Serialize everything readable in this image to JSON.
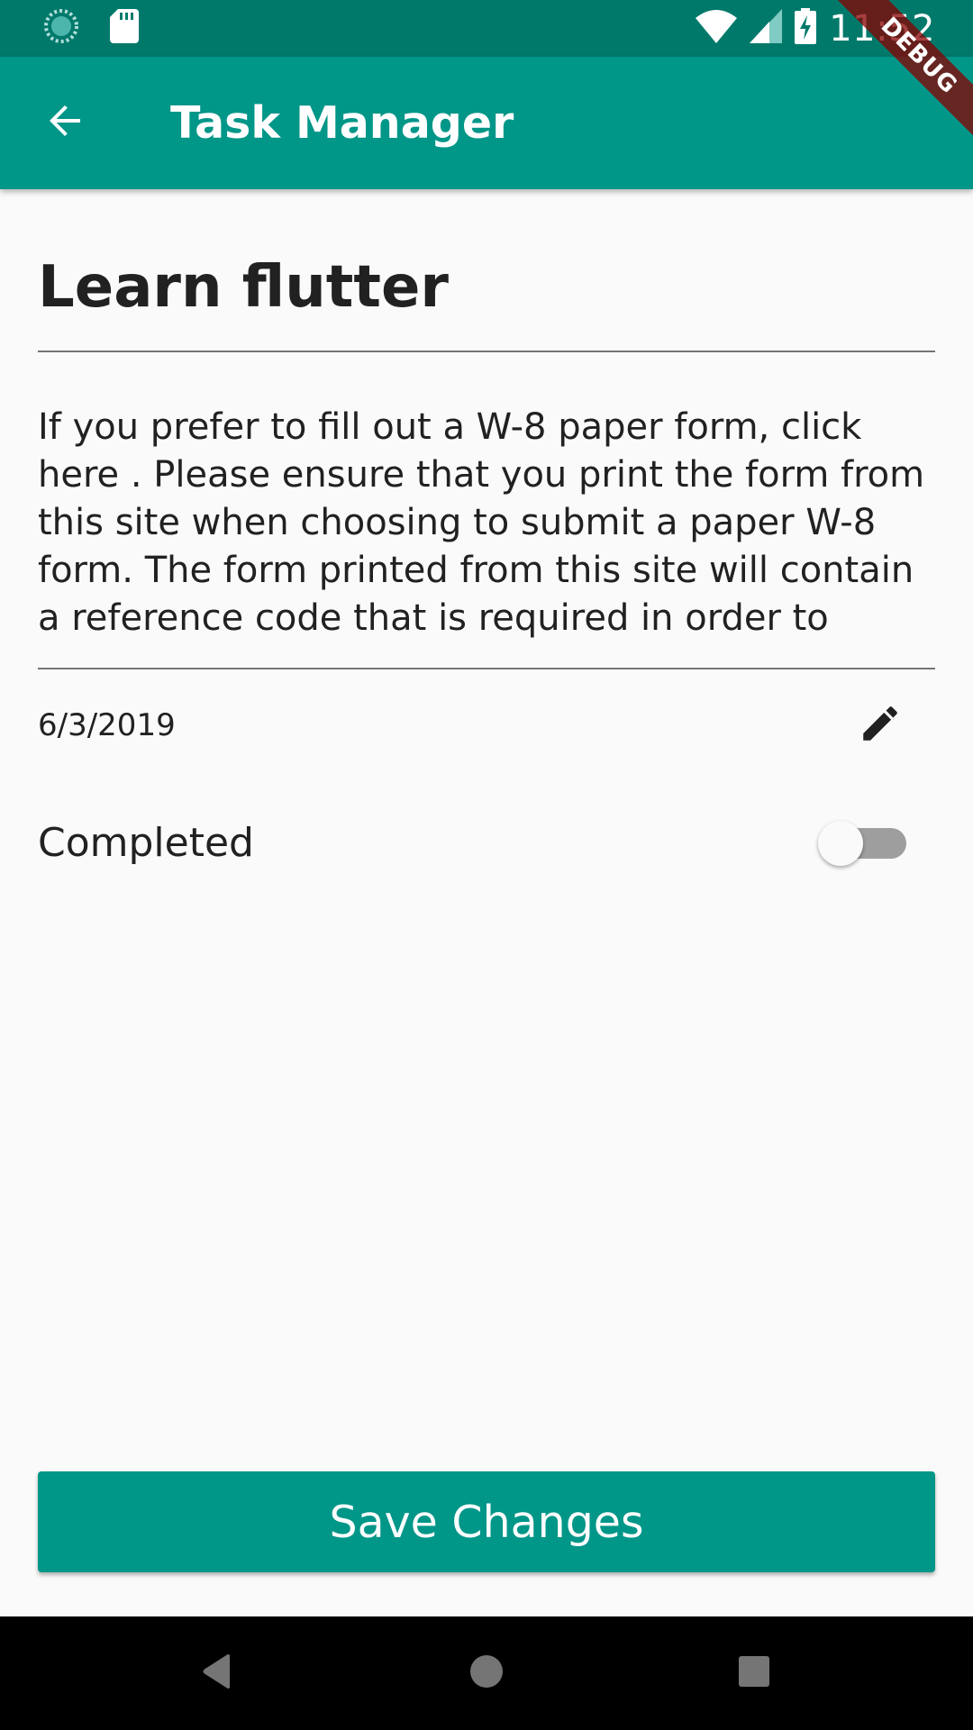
{
  "status_bar": {
    "time": "11:52",
    "icons": [
      "sync-icon",
      "sd-card-icon",
      "wifi-icon",
      "signal-icon",
      "battery-charging-icon"
    ]
  },
  "app_bar": {
    "title": "Task Manager",
    "back_icon": "arrow-back-icon"
  },
  "debug_banner": "DEBUG",
  "task": {
    "title": "Learn flutter",
    "description": "If you prefer to fill out a W-8 paper form, click here . Please ensure that you print the form from this site when choosing to submit a paper W-8 form. The form printed from this site will contain a reference code that is required in order to",
    "date": "6/3/2019",
    "completed_label": "Completed",
    "completed": false
  },
  "actions": {
    "save_label": "Save Changes"
  },
  "colors": {
    "primary": "#009688",
    "primary_dark": "#00796b",
    "text": "#212121",
    "background": "#fafafa"
  }
}
